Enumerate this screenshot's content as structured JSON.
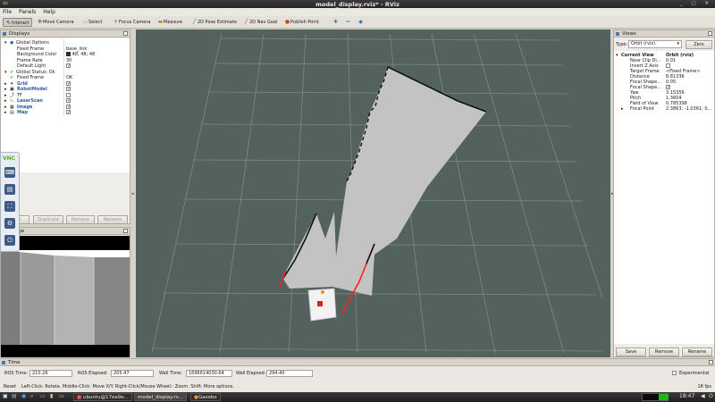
{
  "window": {
    "title": "model_display.rviz* - RViz",
    "app_icon": "qv"
  },
  "menu": [
    "File",
    "Panels",
    "Help"
  ],
  "toolbar": [
    {
      "label": "Interact",
      "icon": "interact-icon"
    },
    {
      "label": "Move Camera",
      "icon": "move-camera-icon"
    },
    {
      "label": "Select",
      "icon": "select-icon"
    },
    {
      "label": "Focus Camera",
      "icon": "focus-camera-icon"
    },
    {
      "label": "Measure",
      "icon": "measure-icon"
    },
    {
      "label": "2D Pose Estimate",
      "icon": "pose-estimate-icon"
    },
    {
      "label": "2D Nav Goal",
      "icon": "nav-goal-icon"
    },
    {
      "label": "Publish Point",
      "icon": "publish-point-icon"
    }
  ],
  "displays": {
    "title": "Displays",
    "rows": [
      {
        "label": "Global Options",
        "value": ""
      },
      {
        "label": "Fixed Frame",
        "value": "base_link"
      },
      {
        "label": "Background Color",
        "value": "48; 48; 48"
      },
      {
        "label": "Frame Rate",
        "value": "30"
      },
      {
        "label": "Default Light",
        "value": "✓"
      },
      {
        "label": "Global Status: Ok",
        "value": ""
      },
      {
        "label": "Fixed Frame",
        "value": "OK"
      },
      {
        "label": "Grid",
        "value": "✓"
      },
      {
        "label": "RobotModel",
        "value": "✓"
      },
      {
        "label": "TF",
        "value": ""
      },
      {
        "label": "LaserScan",
        "value": "✓"
      },
      {
        "label": "Image",
        "value": "✓"
      },
      {
        "label": "Map",
        "value": "✓"
      }
    ],
    "buttons": [
      "Add",
      "Duplicate",
      "Remove",
      "Rename"
    ]
  },
  "image_panel": {
    "title": "Image"
  },
  "vnc": {
    "logo": "VNC"
  },
  "views": {
    "title": "Views",
    "type_label": "Type:",
    "type_value": "Orbit (rviz)",
    "zero_label": "Zero",
    "current_view": "Current View",
    "current_view_value": "Orbit (rviz)",
    "rows": [
      {
        "label": "Near Clip Di...",
        "value": "0.01"
      },
      {
        "label": "Invert Z Axis",
        "value": ""
      },
      {
        "label": "Target Frame",
        "value": "<Fixed Frame>"
      },
      {
        "label": "Distance",
        "value": "8.81336"
      },
      {
        "label": "Focal Shape...",
        "value": "0.05"
      },
      {
        "label": "Focal Shape...",
        "value": "✓"
      },
      {
        "label": "Yaw",
        "value": "3.15356"
      },
      {
        "label": "Pitch",
        "value": "1.3604"
      },
      {
        "label": "Field of View",
        "value": "0.785398"
      },
      {
        "label": "Focal Point",
        "value": "2.3863; -1.0361; 0..."
      }
    ],
    "buttons": [
      "Save",
      "Remove",
      "Rename"
    ]
  },
  "time": {
    "title": "Time",
    "ros_time_label": "ROS Time:",
    "ros_time": "210.26",
    "ros_elapsed_label": "ROS Elapsed:",
    "ros_elapsed": "205.47",
    "wall_time_label": "Wall Time:",
    "wall_time": "1696614030.64",
    "wall_elapsed_label": "Wall Elapsed:",
    "wall_elapsed": "294.40",
    "experimental_label": "Experimental"
  },
  "statusbar": {
    "reset": "Reset",
    "help": "Left-Click: Rotate. Middle-Click: Move X/Y. Right-Click/Mouse Wheel:: Zoom. Shift: More options.",
    "fps": "18 fps"
  },
  "taskbar": {
    "items": [
      "ubuntu@17ea9e...",
      "model_display.rv...",
      "Gazebo"
    ],
    "clock": "18:47"
  },
  "colors": {
    "viewport_bg": "#53625c",
    "map_free": "#c3c3c3",
    "laser": "#ff2020"
  }
}
